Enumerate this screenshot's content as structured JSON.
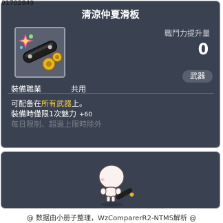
{
  "item_id": "01702849",
  "item_name": "清涼仲夏滑板",
  "stat": {
    "label": "戰鬥力提升量",
    "value": "0"
  },
  "category_badge": "武器",
  "job": {
    "label": "裝備職業",
    "value": "共用"
  },
  "description": {
    "line1_prefix": "可配备在",
    "line1_highlight": "所有武器",
    "line1_suffix": "上。",
    "line2_text": "裝備時僅限1次魅力",
    "line2_bonus": "+60",
    "line3_text": "每日限制、超過上限時除外"
  },
  "footer": "@ 数据由小册子整理，WzComparerR2-NTMS解析 @",
  "icons": {
    "item_icon": "skateboard-icon",
    "character": "character-preview-icon"
  },
  "colors": {
    "panel_bg": "#3a4150",
    "highlight": "#f2c94c",
    "muted": "#7b808b"
  }
}
